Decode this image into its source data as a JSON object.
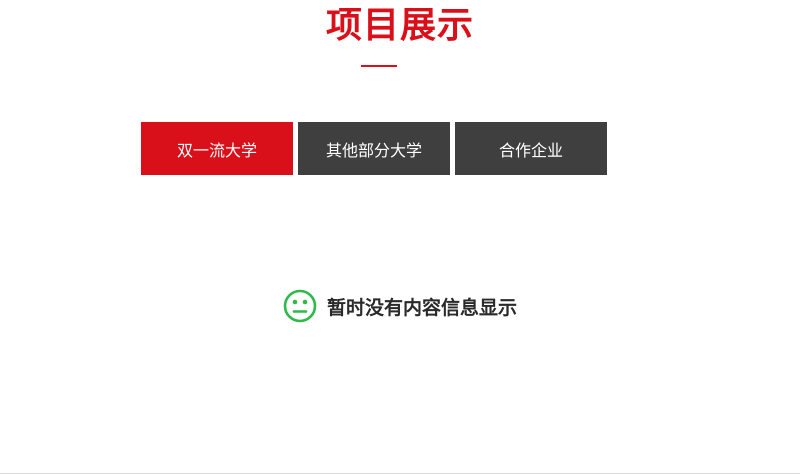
{
  "section": {
    "title": "项目展示"
  },
  "tabs": [
    {
      "label": "双一流大学",
      "active": true
    },
    {
      "label": "其他部分大学",
      "active": false
    },
    {
      "label": "合作企业",
      "active": false
    }
  ],
  "empty_state": {
    "icon": "neutral-face-icon",
    "message": "暂时没有内容信息显示"
  },
  "colors": {
    "accent": "#d9101a",
    "tab_inactive": "#3f3f3f",
    "icon": "#2fb94a"
  }
}
